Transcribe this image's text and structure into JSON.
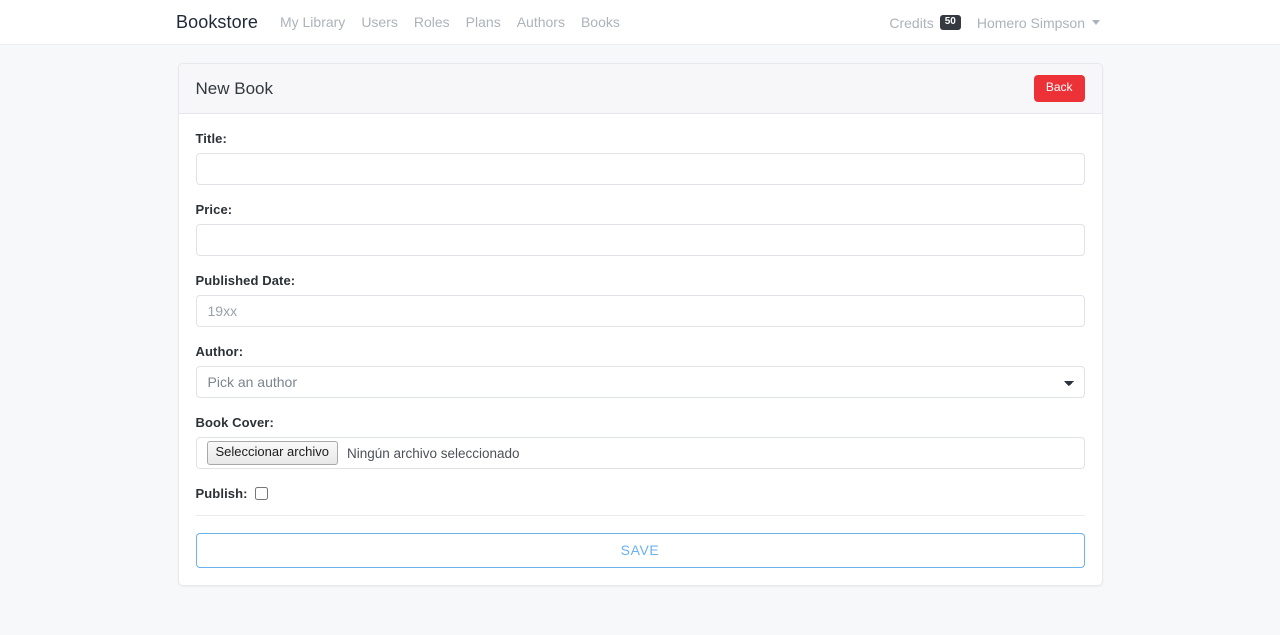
{
  "navbar": {
    "brand": "Bookstore",
    "links": [
      {
        "label": "My Library"
      },
      {
        "label": "Users"
      },
      {
        "label": "Roles"
      },
      {
        "label": "Plans"
      },
      {
        "label": "Authors"
      },
      {
        "label": "Books"
      }
    ],
    "credits": {
      "label": "Credits",
      "count": "50",
      "badge_color": "#343a40"
    },
    "user": {
      "name": "Homero Simpson",
      "caret_icon": "chevron-down-icon"
    }
  },
  "card": {
    "title": "New Book",
    "back_button": {
      "label": "Back",
      "color": "#ec3237"
    }
  },
  "form": {
    "title": {
      "label": "Title:",
      "value": "",
      "placeholder": ""
    },
    "price": {
      "label": "Price:",
      "value": "",
      "placeholder": ""
    },
    "published_date": {
      "label": "Published Date:",
      "value": "",
      "placeholder": "19xx"
    },
    "author": {
      "label": "Author:",
      "selected": "Pick an author",
      "options": [
        "Pick an author"
      ]
    },
    "book_cover": {
      "label": "Book Cover:",
      "button_label": "Seleccionar archivo",
      "file_status": "Ningún archivo seleccionado"
    },
    "publish": {
      "label": "Publish:",
      "checked": false
    },
    "save_button": {
      "label": "SAVE",
      "color": "#6cb2eb"
    }
  }
}
